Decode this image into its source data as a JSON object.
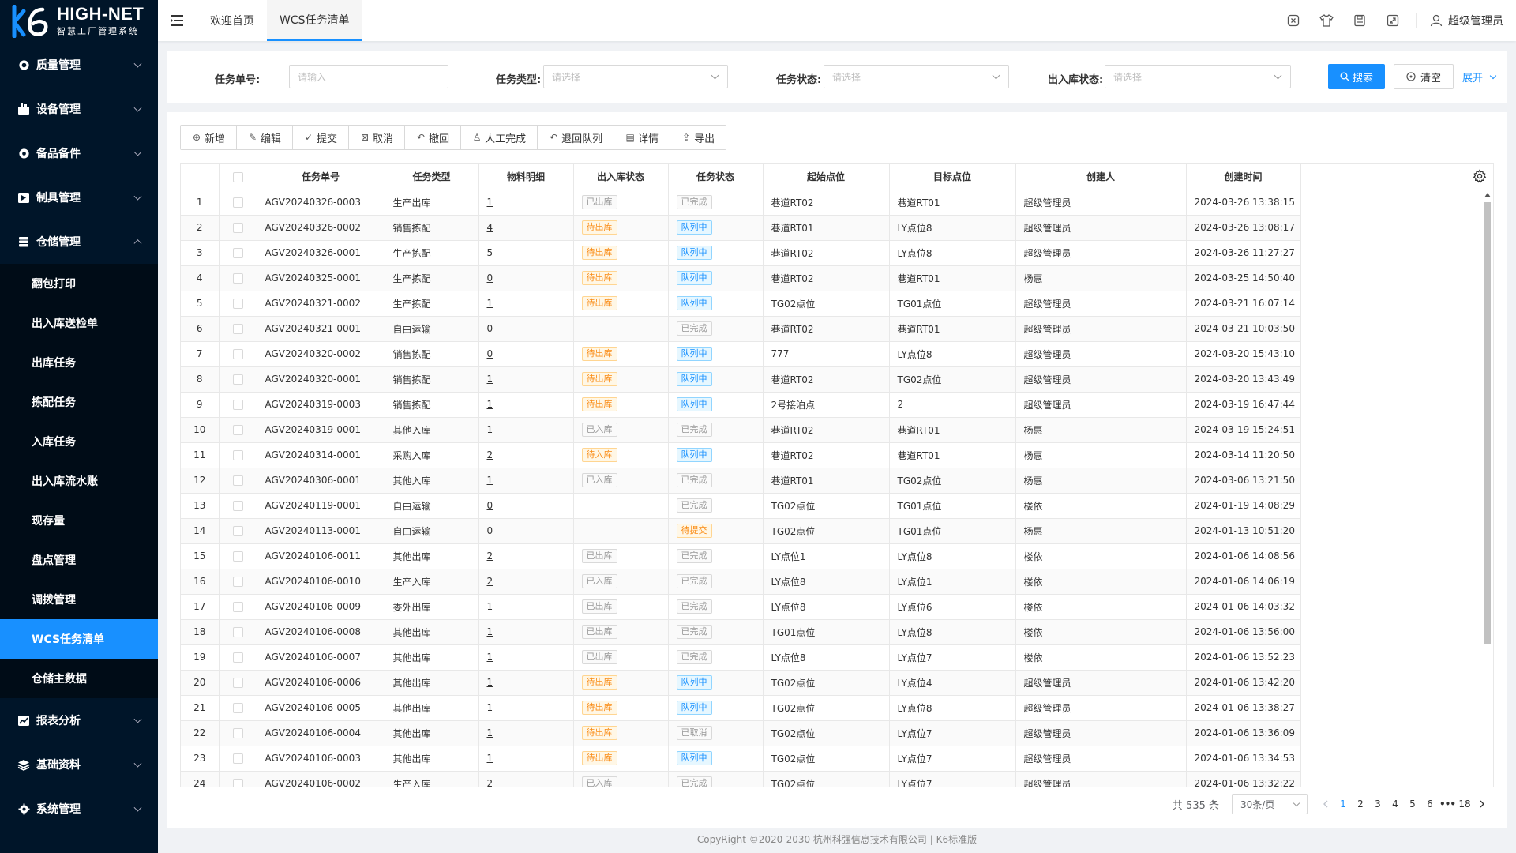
{
  "app": {
    "logo_title": "HIGH-NET",
    "logo_subtitle": "智慧工厂管理系统",
    "brand_color": "#1890ff"
  },
  "sidebar": {
    "groups_top": [
      {
        "label": "质量管理",
        "icon": "shield-icon"
      },
      {
        "label": "设备管理",
        "icon": "machine-icon"
      },
      {
        "label": "备品备件",
        "icon": "gear-icon"
      },
      {
        "label": "制具管理",
        "icon": "tool-icon"
      }
    ],
    "warehouse": {
      "label": "仓储管理",
      "icon": "database-icon",
      "items": [
        "翻包打印",
        "出入库送检单",
        "出库任务",
        "拣配任务",
        "入库任务",
        "出入库流水账",
        "现存量",
        "盘点管理",
        "调拨管理",
        "WCS任务清单",
        "仓储主数据"
      ],
      "active_index": 9
    },
    "groups_bottom": [
      {
        "label": "报表分析",
        "icon": "chart-icon"
      },
      {
        "label": "基础资料",
        "icon": "layers-icon"
      },
      {
        "label": "系统管理",
        "icon": "settings-icon"
      }
    ]
  },
  "header": {
    "tabs": [
      "欢迎首页",
      "WCS任务清单"
    ],
    "active_tab": 1,
    "user": "超级管理员"
  },
  "search": {
    "task_no_label": "任务单号:",
    "task_no_placeholder": "请输入",
    "task_type_label": "任务类型:",
    "task_type_placeholder": "请选择",
    "task_status_label": "任务状态:",
    "task_status_placeholder": "请选择",
    "io_status_label": "出入库状态:",
    "io_status_placeholder": "请选择",
    "search_btn": "搜索",
    "clear_btn": "清空",
    "expand": "展开"
  },
  "toolbar": [
    {
      "label": "新增",
      "icon": "plus-circle-icon",
      "glyph": "⊕"
    },
    {
      "label": "编辑",
      "icon": "edit-icon",
      "glyph": "✎"
    },
    {
      "label": "提交",
      "icon": "check-circle-icon",
      "glyph": "✓"
    },
    {
      "label": "取消",
      "icon": "close-square-icon",
      "glyph": "⊠"
    },
    {
      "label": "撤回",
      "icon": "undo-icon",
      "glyph": "↶"
    },
    {
      "label": "人工完成",
      "icon": "user-icon",
      "glyph": "♙"
    },
    {
      "label": "退回队列",
      "icon": "return-icon",
      "glyph": "↶"
    },
    {
      "label": "详情",
      "icon": "detail-icon",
      "glyph": "▤"
    },
    {
      "label": "导出",
      "icon": "export-icon",
      "glyph": "⇪"
    }
  ],
  "table": {
    "columns": [
      "",
      "",
      "任务单号",
      "任务类型",
      "物料明细",
      "出入库状态",
      "任务状态",
      "起始点位",
      "目标点位",
      "创建人",
      "创建时间"
    ],
    "rows": [
      [
        "1",
        "AGV20240326-0003",
        "生产出库",
        "1",
        "已出库",
        "已完成",
        "巷道RT02",
        "巷道RT01",
        "超级管理员",
        "2024-03-26 13:38:15"
      ],
      [
        "2",
        "AGV20240326-0002",
        "销售拣配",
        "4",
        "待出库",
        "队列中",
        "巷道RT01",
        "LY点位8",
        "超级管理员",
        "2024-03-26 13:08:17"
      ],
      [
        "3",
        "AGV20240326-0001",
        "生产拣配",
        "5",
        "待出库",
        "队列中",
        "巷道RT02",
        "LY点位8",
        "超级管理员",
        "2024-03-26 11:27:27"
      ],
      [
        "4",
        "AGV20240325-0001",
        "生产拣配",
        "0",
        "待出库",
        "队列中",
        "巷道RT02",
        "巷道RT01",
        "杨惠",
        "2024-03-25 14:50:40"
      ],
      [
        "5",
        "AGV20240321-0002",
        "生产拣配",
        "1",
        "待出库",
        "队列中",
        "TG02点位",
        "TG01点位",
        "超级管理员",
        "2024-03-21 16:07:14"
      ],
      [
        "6",
        "AGV20240321-0001",
        "自由运输",
        "0",
        "",
        "已完成",
        "巷道RT02",
        "巷道RT01",
        "超级管理员",
        "2024-03-21 10:03:50"
      ],
      [
        "7",
        "AGV20240320-0002",
        "销售拣配",
        "0",
        "待出库",
        "队列中",
        "777",
        "LY点位8",
        "超级管理员",
        "2024-03-20 15:43:10"
      ],
      [
        "8",
        "AGV20240320-0001",
        "销售拣配",
        "1",
        "待出库",
        "队列中",
        "巷道RT02",
        "TG02点位",
        "超级管理员",
        "2024-03-20 13:43:49"
      ],
      [
        "9",
        "AGV20240319-0003",
        "销售拣配",
        "1",
        "待出库",
        "队列中",
        "2号接泊点",
        "2",
        "超级管理员",
        "2024-03-19 16:47:44"
      ],
      [
        "10",
        "AGV20240319-0001",
        "其他入库",
        "1",
        "已入库",
        "已完成",
        "巷道RT02",
        "巷道RT01",
        "杨惠",
        "2024-03-19 15:24:51"
      ],
      [
        "11",
        "AGV20240314-0001",
        "采购入库",
        "2",
        "待入库",
        "队列中",
        "巷道RT02",
        "巷道RT01",
        "杨惠",
        "2024-03-14 11:20:50"
      ],
      [
        "12",
        "AGV20240306-0001",
        "其他入库",
        "1",
        "已入库",
        "已完成",
        "巷道RT01",
        "TG02点位",
        "杨惠",
        "2024-03-06 13:21:50"
      ],
      [
        "13",
        "AGV20240119-0001",
        "自由运输",
        "0",
        "",
        "已完成",
        "TG02点位",
        "TG01点位",
        "楼依",
        "2024-01-19 14:08:29"
      ],
      [
        "14",
        "AGV20240113-0001",
        "自由运输",
        "0",
        "",
        "待提交",
        "TG02点位",
        "TG01点位",
        "杨惠",
        "2024-01-13 10:51:20"
      ],
      [
        "15",
        "AGV20240106-0011",
        "其他出库",
        "2",
        "已出库",
        "已完成",
        "LY点位1",
        "LY点位8",
        "楼依",
        "2024-01-06 14:08:56"
      ],
      [
        "16",
        "AGV20240106-0010",
        "生产入库",
        "2",
        "已入库",
        "已完成",
        "LY点位8",
        "LY点位1",
        "楼依",
        "2024-01-06 14:06:19"
      ],
      [
        "17",
        "AGV20240106-0009",
        "委外出库",
        "1",
        "已出库",
        "已完成",
        "LY点位8",
        "LY点位6",
        "楼依",
        "2024-01-06 14:03:32"
      ],
      [
        "18",
        "AGV20240106-0008",
        "其他出库",
        "1",
        "已出库",
        "已完成",
        "TG01点位",
        "LY点位8",
        "楼依",
        "2024-01-06 13:56:00"
      ],
      [
        "19",
        "AGV20240106-0007",
        "其他出库",
        "1",
        "已出库",
        "已完成",
        "LY点位8",
        "LY点位7",
        "楼依",
        "2024-01-06 13:52:23"
      ],
      [
        "20",
        "AGV20240106-0006",
        "其他出库",
        "1",
        "待出库",
        "队列中",
        "TG02点位",
        "LY点位4",
        "超级管理员",
        "2024-01-06 13:42:20"
      ],
      [
        "21",
        "AGV20240106-0005",
        "其他出库",
        "1",
        "待出库",
        "队列中",
        "TG02点位",
        "LY点位8",
        "超级管理员",
        "2024-01-06 13:38:27"
      ],
      [
        "22",
        "AGV20240106-0004",
        "其他出库",
        "1",
        "待出库",
        "已取消",
        "TG02点位",
        "LY点位7",
        "超级管理员",
        "2024-01-06 13:36:09"
      ],
      [
        "23",
        "AGV20240106-0003",
        "其他出库",
        "1",
        "待出库",
        "队列中",
        "TG02点位",
        "LY点位7",
        "超级管理员",
        "2024-01-06 13:34:53"
      ],
      [
        "24",
        "AGV20240106-0002",
        "生产入库",
        "2",
        "已入库",
        "已完成",
        "TG02点位",
        "LY点位7",
        "超级管理员",
        "2024-01-06 13:32:22"
      ]
    ]
  },
  "pagination": {
    "total": "共 535 条",
    "page_size": "30条/页",
    "pages": [
      "1",
      "2",
      "3",
      "4",
      "5",
      "6"
    ],
    "ellipsis": "•••",
    "last": "18",
    "current": "1"
  },
  "footer": {
    "copyright": "CopyRight ©2020-2030 杭州科强信息技术有限公司 | K6标准版"
  }
}
